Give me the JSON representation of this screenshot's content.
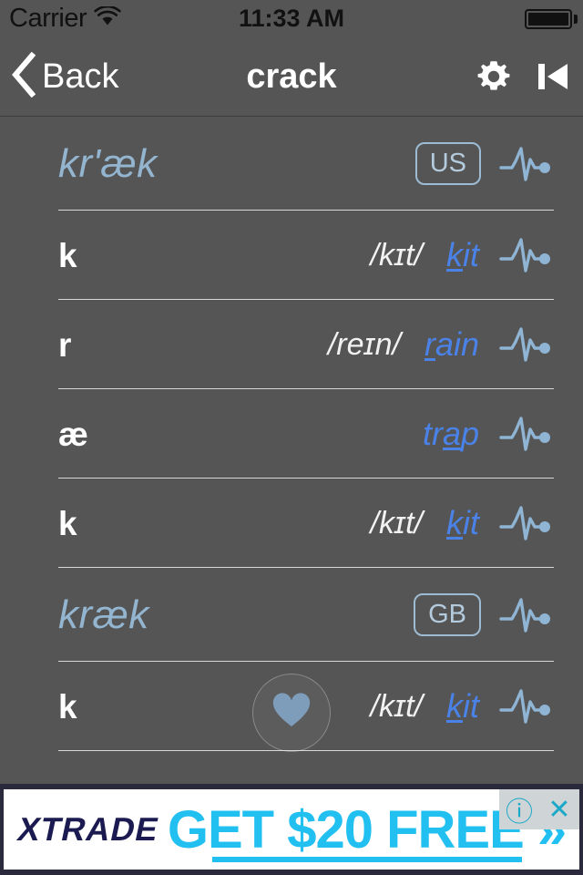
{
  "statusbar": {
    "carrier": "Carrier",
    "wifi_icon": "wifi-icon",
    "time": "11:33 AM",
    "battery_icon": "battery-full-icon"
  },
  "navbar": {
    "back_label": "Back",
    "back_icon": "chevron-left-icon",
    "title": "crack",
    "settings_icon": "gear-icon",
    "previous_icon": "skip-previous-icon"
  },
  "favorite": {
    "icon": "heart-icon"
  },
  "rows": [
    {
      "kind": "header",
      "ipa_heading": "kr'æk",
      "badge": "US",
      "phoneme": "",
      "ipa": "",
      "example_pre": "",
      "example_mark": "",
      "example_post": "",
      "wave_icon": "waveform-play-icon"
    },
    {
      "kind": "phoneme",
      "ipa_heading": "",
      "badge": "",
      "phoneme": "k",
      "ipa": "/kɪt/",
      "example_pre": "",
      "example_mark": "k",
      "example_post": "it",
      "wave_icon": "waveform-play-icon"
    },
    {
      "kind": "phoneme",
      "ipa_heading": "",
      "badge": "",
      "phoneme": "r",
      "ipa": "/reɪn/",
      "example_pre": "",
      "example_mark": "r",
      "example_post": "ain",
      "wave_icon": "waveform-play-icon"
    },
    {
      "kind": "phoneme",
      "ipa_heading": "",
      "badge": "",
      "phoneme": "æ",
      "ipa": "",
      "example_pre": "tr",
      "example_mark": "a",
      "example_post": "p",
      "wave_icon": "waveform-play-icon"
    },
    {
      "kind": "phoneme",
      "ipa_heading": "",
      "badge": "",
      "phoneme": "k",
      "ipa": "/kɪt/",
      "example_pre": "",
      "example_mark": "k",
      "example_post": "it",
      "wave_icon": "waveform-play-icon"
    },
    {
      "kind": "header",
      "ipa_heading": "kræk",
      "badge": "GB",
      "phoneme": "",
      "ipa": "",
      "example_pre": "",
      "example_mark": "",
      "example_post": "",
      "wave_icon": "waveform-play-icon"
    },
    {
      "kind": "phoneme",
      "ipa_heading": "",
      "badge": "",
      "phoneme": "k",
      "ipa": "/kɪt/",
      "example_pre": "",
      "example_mark": "k",
      "example_post": "it",
      "wave_icon": "waveform-play-icon"
    }
  ],
  "ad": {
    "brand": "XTRADE",
    "headline": "GET $20 FREE »",
    "info_icon": "ⓘ",
    "close_icon": "✕"
  },
  "colors": {
    "background": "#555555",
    "separator": "#d8d8d8",
    "heading_blue": "#94b5d0",
    "example_blue": "#4a82e8",
    "badge_border": "#9dbcd4",
    "wave_blue": "#8fb4d4",
    "ad_cyan": "#22c0f0",
    "ad_navy": "#1b1b52"
  }
}
